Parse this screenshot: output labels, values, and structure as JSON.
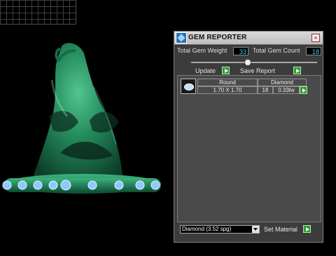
{
  "window": {
    "title": "GEM REPORTER"
  },
  "stats": {
    "total_weight_label": "Total Gem Weight",
    "total_weight_value": "33",
    "total_count_label": "Total Gem Count",
    "total_count_value": "18"
  },
  "actions": {
    "update_label": "Update",
    "save_report_label": "Save Report"
  },
  "report": {
    "rows": [
      {
        "shape": "Round",
        "size": "1.70 X 1.70",
        "material": "Diamond",
        "count": "18",
        "weight": "0.33tw"
      }
    ]
  },
  "material": {
    "selected": "Diamond     (3.52 spg)",
    "set_label": "Set Material"
  },
  "icons": {
    "app": "gem-icon",
    "close": "close-icon",
    "play": "play-icon",
    "dropdown": "chevron-down-icon"
  },
  "colors": {
    "value_text": "#3ad2ff",
    "model_green": "#1f8c5a",
    "gem_blue": "#8fc8ff"
  }
}
